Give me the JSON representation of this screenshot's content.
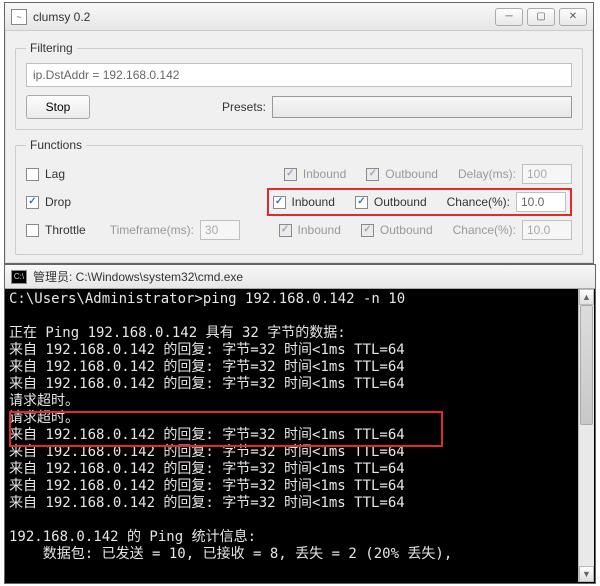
{
  "clumsy": {
    "title": "clumsy 0.2",
    "filtering": {
      "legend": "Filtering",
      "expression": "ip.DstAddr = 192.168.0.142",
      "stop_label": "Stop",
      "presets_label": "Presets:"
    },
    "functions": {
      "legend": "Functions",
      "rows": [
        {
          "name": "Lag",
          "enabled": false,
          "inbound_label": "Inbound",
          "outbound_label": "Outbound",
          "param_label": "Delay(ms):",
          "param_value": "100"
        },
        {
          "name": "Drop",
          "enabled": true,
          "inbound_label": "Inbound",
          "outbound_label": "Outbound",
          "param_label": "Chance(%):",
          "param_value": "10.0"
        },
        {
          "name": "Throttle",
          "enabled": false,
          "tf_label": "Timeframe(ms):",
          "tf_value": "30",
          "inbound_label": "Inbound",
          "outbound_label": "Outbound",
          "param_label": "Chance(%):",
          "param_value": "10.0"
        }
      ]
    }
  },
  "cmd": {
    "title": "管理员: C:\\Windows\\system32\\cmd.exe",
    "prompt": "C:\\Users\\Administrator>",
    "command": "ping 192.168.0.142 -n 10",
    "header": "正在 Ping 192.168.0.142 具有 32 字节的数据:",
    "replies_top": [
      "来自 192.168.0.142 的回复: 字节=32 时间<1ms TTL=64",
      "来自 192.168.0.142 的回复: 字节=32 时间<1ms TTL=64",
      "来自 192.168.0.142 的回复: 字节=32 时间<1ms TTL=64"
    ],
    "timeouts": [
      "请求超时。",
      "请求超时。"
    ],
    "replies_bottom": [
      "来自 192.168.0.142 的回复: 字节=32 时间<1ms TTL=64",
      "来自 192.168.0.142 的回复: 字节=32 时间<1ms TTL=64",
      "来自 192.168.0.142 的回复: 字节=32 时间<1ms TTL=64",
      "来自 192.168.0.142 的回复: 字节=32 时间<1ms TTL=64",
      "来自 192.168.0.142 的回复: 字节=32 时间<1ms TTL=64"
    ],
    "stats_header": "192.168.0.142 的 Ping 统计信息:",
    "stats_line": "    数据包: 已发送 = 10, 已接收 = 8, 丢失 = 2 (20% 丢失),"
  }
}
